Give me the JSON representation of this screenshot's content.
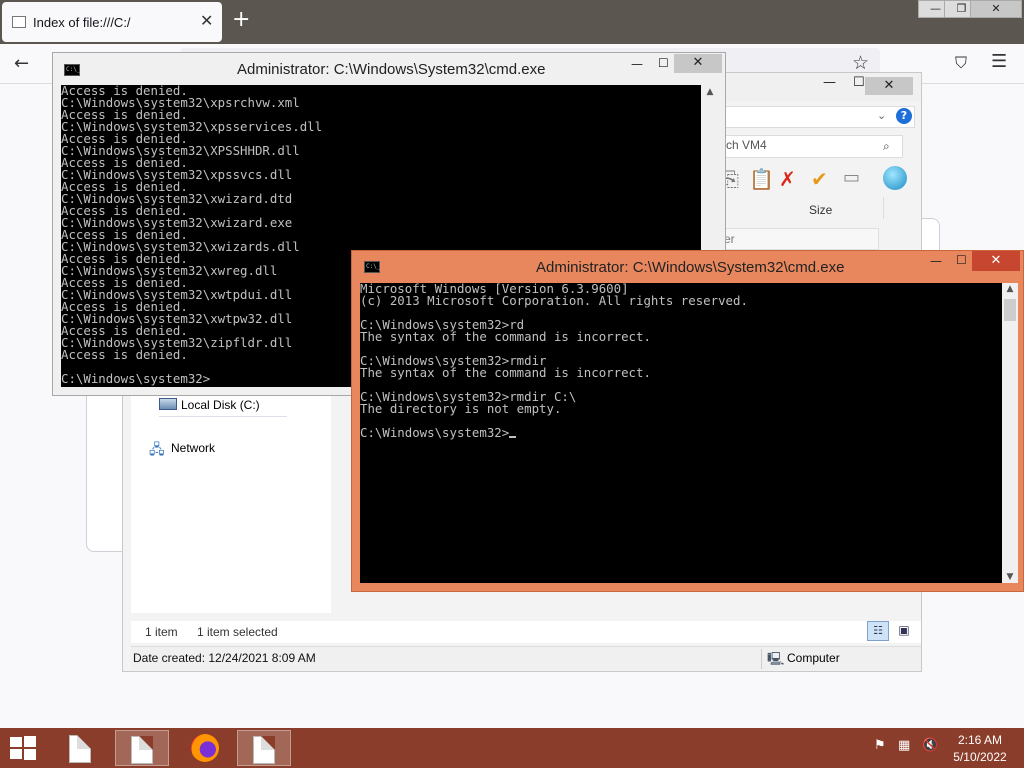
{
  "firefox": {
    "tab_title": "Index of file:///C:/",
    "tab_close": "✕",
    "new_tab": "+",
    "win_min": "—",
    "win_max": "❐",
    "win_close": "✕",
    "back": "←",
    "star": "☆",
    "pocket": "⛉",
    "menu": "☰"
  },
  "explorer": {
    "min": "—",
    "max": "☐",
    "close": "✕",
    "address_chevron": "⌄",
    "help": "?",
    "search_placeholder": "rch VM4",
    "search_icon": "⌕",
    "toolbar_icons": {
      "copy": "⎘",
      "paste": "📋",
      "delete": "✗",
      "check": "✔",
      "properties": "▭"
    },
    "column_size": "Size",
    "filter_text": "er",
    "nav": {
      "local_disk": "Local Disk (C:)",
      "network": "Network",
      "network_icon": "🖧"
    },
    "status": {
      "item_count": "1 item",
      "selected": "1 item selected",
      "view_details_icon": "☷",
      "view_tiles_icon": "▣"
    },
    "details": {
      "date_created": "Date created: 12/24/2021 8:09 AM",
      "location": "Computer",
      "location_icon": "🖳"
    }
  },
  "cmd_back": {
    "title": "Administrator: C:\\Windows\\System32\\cmd.exe",
    "icon_text": "C:\\_",
    "min": "—",
    "max": "☐",
    "close": "✕",
    "lines": [
      "Access is denied.",
      "C:\\Windows\\system32\\xpsrchvw.xml",
      "Access is denied.",
      "C:\\Windows\\system32\\xpsservices.dll",
      "Access is denied.",
      "C:\\Windows\\system32\\XPSSHHDR.dll",
      "Access is denied.",
      "C:\\Windows\\system32\\xpssvcs.dll",
      "Access is denied.",
      "C:\\Windows\\system32\\xwizard.dtd",
      "Access is denied.",
      "C:\\Windows\\system32\\xwizard.exe",
      "Access is denied.",
      "C:\\Windows\\system32\\xwizards.dll",
      "Access is denied.",
      "C:\\Windows\\system32\\xwreg.dll",
      "Access is denied.",
      "C:\\Windows\\system32\\xwtpdui.dll",
      "Access is denied.",
      "C:\\Windows\\system32\\xwtpw32.dll",
      "Access is denied.",
      "C:\\Windows\\system32\\zipfldr.dll",
      "Access is denied.",
      "",
      "C:\\Windows\\system32>"
    ],
    "scroll_up": "▲"
  },
  "cmd_front": {
    "title": "Administrator: C:\\Windows\\System32\\cmd.exe",
    "icon_text": "C:\\_",
    "min": "—",
    "max": "☐",
    "close": "✕",
    "lines": [
      "Microsoft Windows [Version 6.3.9600]",
      "(c) 2013 Microsoft Corporation. All rights reserved.",
      "",
      "C:\\Windows\\system32>rd",
      "The syntax of the command is incorrect.",
      "",
      "C:\\Windows\\system32>rmdir",
      "The syntax of the command is incorrect.",
      "",
      "C:\\Windows\\system32>rmdir C:\\",
      "The directory is not empty.",
      ""
    ],
    "prompt": "C:\\Windows\\system32>",
    "scroll_up": "▲",
    "scroll_down": "▼"
  },
  "taskbar": {
    "tray": {
      "flag": "⚑",
      "network": "▦",
      "volume": "🔇"
    },
    "time": "2:16 AM",
    "date": "5/10/2022"
  }
}
